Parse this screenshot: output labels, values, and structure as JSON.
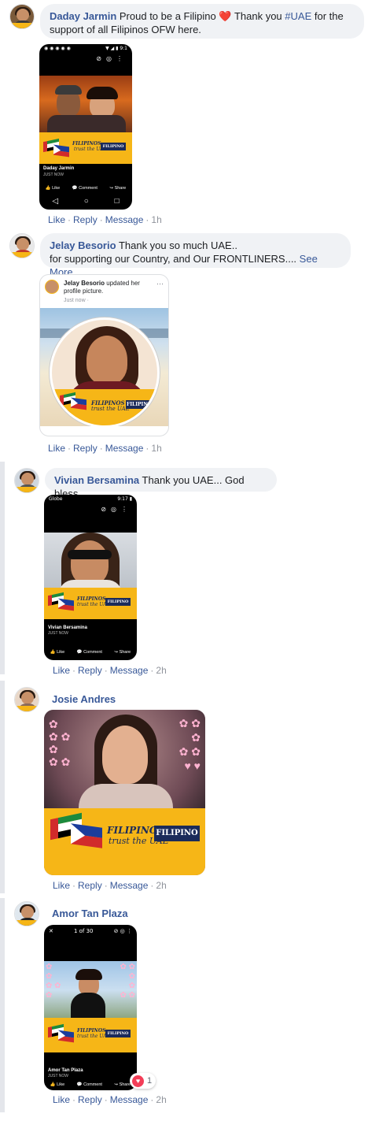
{
  "actions": {
    "like": "Like",
    "reply": "Reply",
    "message": "Message",
    "separator": "·"
  },
  "colors": {
    "link": "#385898",
    "bubble": "#f0f2f5",
    "banner_yellow": "#f6b617",
    "navy": "#1b2b5a",
    "heart": "#f33e58"
  },
  "badge": {
    "line1": "FILIPINOS",
    "line2": "trust the UAE",
    "paper": "FILIPINO"
  },
  "comments": [
    {
      "author": "Daday Jarmin",
      "text_before": "Proud to be a Filipino",
      "emoji": "heart-emoji",
      "text_mid": "Thank you",
      "hashtag": "#UAE",
      "text_after": "for the support of all Filipinos OFW here.",
      "time": "1h",
      "shot": {
        "poster": "Daday Jarmin",
        "poster_time": "JUST NOW",
        "fb_like": "Like",
        "fb_comment": "Comment",
        "fb_share": "Share"
      }
    },
    {
      "author": "Jelay Besorio",
      "text_line1": "Thank you so much UAE..",
      "text_line2": "for supporting our Country, and Our FRONTLINERS....",
      "see_more": "See More",
      "time": "1h",
      "card": {
        "name": "Jelay Besorio",
        "action": "updated her profile picture.",
        "sub": "Just now ·"
      }
    },
    {
      "author": "Vivian Bersamina",
      "text": "Thank you UAE... God bless",
      "time": "2h",
      "shot": {
        "poster": "Vivian Bersamina",
        "poster_time": "JUST NOW",
        "fb_like": "Like",
        "fb_comment": "Comment",
        "fb_share": "Share"
      }
    },
    {
      "author": "Josie Andres",
      "time": "2h"
    },
    {
      "author": "Amor Tan Plaza",
      "time": "2h",
      "shot": {
        "counter": "1 of 30",
        "poster": "Amor Tan Plaza",
        "poster_time": "JUST NOW",
        "fb_like": "Like",
        "fb_comment": "Comment",
        "fb_share": "Share"
      },
      "reaction_count": "1"
    }
  ]
}
